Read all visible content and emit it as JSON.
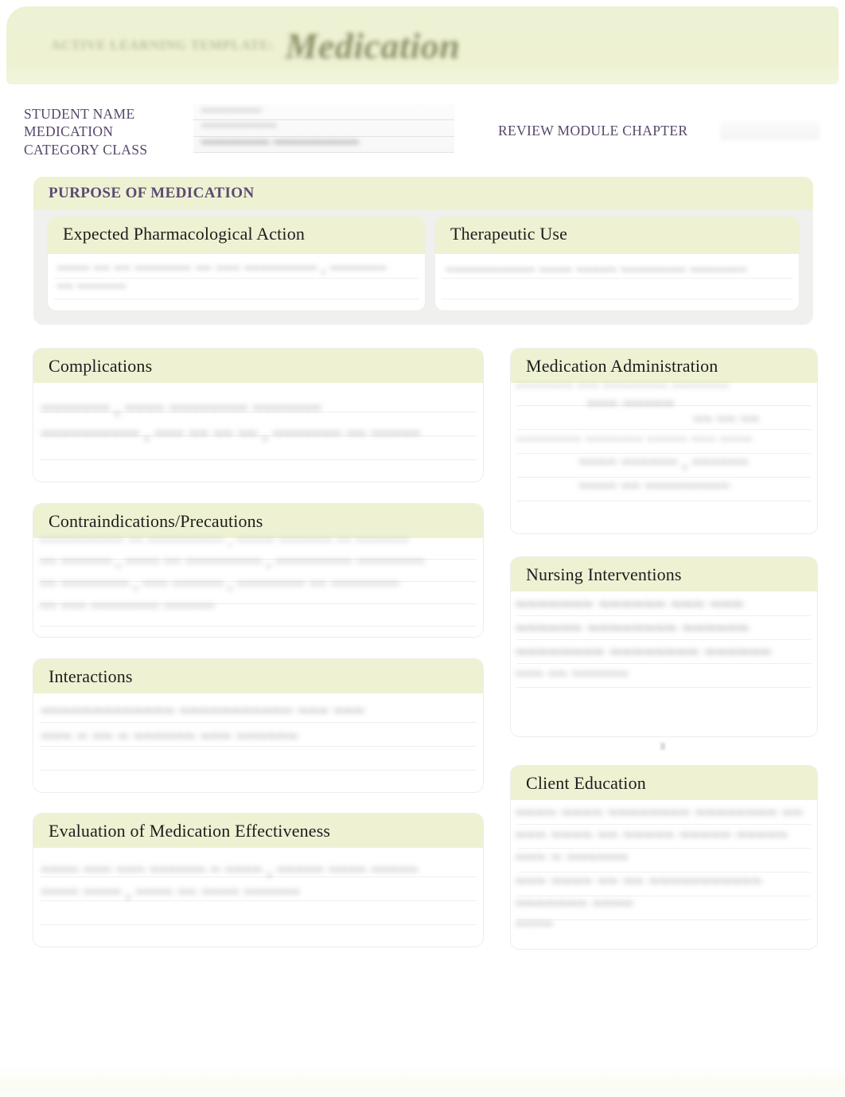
{
  "masthead": {
    "kicker": "ACTIVE LEARNING TEMPLATE:",
    "title": "Medication",
    "band_color": "#eef2d3"
  },
  "identity": {
    "labels": {
      "student_name": "STUDENT NAME",
      "medication": "MEDICATION",
      "category_class": "CATEGORY CLASS"
    },
    "values": {
      "student_name": "",
      "medication": "",
      "category_class": ""
    },
    "review_module_chapter_label": "REVIEW MODULE CHAPTER",
    "review_module_chapter_value": ""
  },
  "purpose": {
    "title": "PURPOSE OF MEDICATION",
    "title_color": "#5c4a72",
    "expected_pharmacological_action": {
      "label": "Expected Pharmacological Action",
      "value": ""
    },
    "therapeutic_use": {
      "label": "Therapeutic Use",
      "value": ""
    }
  },
  "left_column": [
    {
      "label": "Complications",
      "value": ""
    },
    {
      "label": "Contraindications/Precautions",
      "value": ""
    },
    {
      "label": "Interactions",
      "value": ""
    },
    {
      "label": "Evaluation of Medication Effectiveness",
      "value": ""
    }
  ],
  "right_column": [
    {
      "label": "Medication Administration",
      "value": ""
    },
    {
      "label": "Nursing Interventions",
      "value": ""
    },
    {
      "label": "Client Education",
      "value": ""
    }
  ]
}
